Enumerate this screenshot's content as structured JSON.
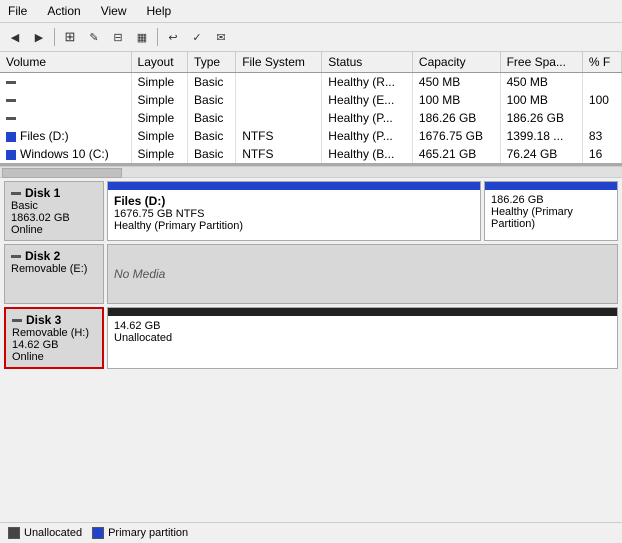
{
  "menu": {
    "items": [
      "File",
      "Action",
      "View",
      "Help"
    ]
  },
  "toolbar": {
    "buttons": [
      "◀",
      "▶",
      "⊞",
      "✎",
      "⊟",
      "▦",
      "↩",
      "✓",
      "✉"
    ]
  },
  "table": {
    "columns": [
      "Volume",
      "Layout",
      "Type",
      "File System",
      "Status",
      "Capacity",
      "Free Spa...",
      "% F"
    ],
    "rows": [
      {
        "volume": "",
        "layout": "Simple",
        "type": "Basic",
        "filesystem": "",
        "status": "Healthy (R...",
        "capacity": "450 MB",
        "freespace": "450 MB",
        "percent": ""
      },
      {
        "volume": "",
        "layout": "Simple",
        "type": "Basic",
        "filesystem": "",
        "status": "Healthy (E...",
        "capacity": "100 MB",
        "freespace": "100 MB",
        "percent": "100"
      },
      {
        "volume": "",
        "layout": "Simple",
        "type": "Basic",
        "filesystem": "",
        "status": "Healthy (P...",
        "capacity": "186.26 GB",
        "freespace": "186.26 GB",
        "percent": ""
      },
      {
        "volume": "Files (D:)",
        "layout": "Simple",
        "type": "Basic",
        "filesystem": "NTFS",
        "status": "Healthy (P...",
        "capacity": "1676.75 GB",
        "freespace": "1399.18 ...",
        "percent": "83"
      },
      {
        "volume": "Windows 10 (C:)",
        "layout": "Simple",
        "type": "Basic",
        "filesystem": "NTFS",
        "status": "Healthy (B...",
        "capacity": "465.21 GB",
        "freespace": "76.24 GB",
        "percent": "16"
      }
    ]
  },
  "disks": [
    {
      "id": "disk1",
      "name": "Disk 1",
      "type": "Basic",
      "size": "1863.02 GB",
      "status": "Online",
      "highlighted": false,
      "partitions": [
        {
          "name": "Files (D:)",
          "fs": "1676.75 GB NTFS",
          "status": "Healthy (Primary Partition)",
          "style": "blue-header",
          "flex": 3
        },
        {
          "name": "",
          "fs": "186.26 GB",
          "status": "Healthy (Primary Partition)",
          "style": "blue-header",
          "flex": 1
        }
      ]
    },
    {
      "id": "disk2",
      "name": "Disk 2",
      "type": "Removable (E:)",
      "size": "",
      "status": "",
      "highlighted": false,
      "noMedia": "No Media"
    },
    {
      "id": "disk3",
      "name": "Disk 3",
      "type": "Removable (H:)",
      "size": "14.62 GB",
      "status": "Online",
      "highlighted": true,
      "partitions": [
        {
          "name": "",
          "fs": "14.62 GB",
          "status": "Unallocated",
          "style": "dark-bar",
          "flex": 1
        }
      ]
    }
  ],
  "legend": {
    "items": [
      {
        "label": "Unallocated",
        "color": "#444444"
      },
      {
        "label": "Primary partition",
        "color": "#2244cc"
      }
    ]
  }
}
